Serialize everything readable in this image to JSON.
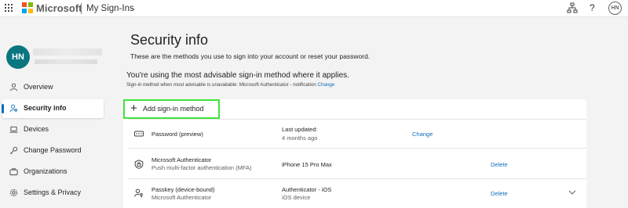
{
  "topbar": {
    "brand": "Microsoft",
    "app_name": "My Sign-Ins",
    "user_initials": "HN",
    "help_label": "?",
    "icons": [
      "app-launcher-icon",
      "microsoft-logo",
      "chevron-down-icon",
      "organization-icon",
      "help-icon"
    ]
  },
  "sidebar": {
    "avatar_initials": "HN",
    "items": [
      {
        "label": "Overview",
        "icon": "person-icon",
        "active": false
      },
      {
        "label": "Security info",
        "icon": "person-key-icon",
        "active": true
      },
      {
        "label": "Devices",
        "icon": "laptop-icon",
        "active": false
      },
      {
        "label": "Change Password",
        "icon": "key-icon",
        "active": false
      },
      {
        "label": "Organizations",
        "icon": "briefcase-icon",
        "active": false
      },
      {
        "label": "Settings & Privacy",
        "icon": "gear-icon",
        "active": false
      }
    ]
  },
  "main": {
    "title": "Security info",
    "subtitle": "These are the methods you use to sign into your account or reset your password.",
    "advice": "You're using the most advisable sign-in method where it applies.",
    "advice_sub": "Sign-in method when most advisable is unavailable: Microsoft Authenticator - notification",
    "advice_link": "Change",
    "add_method_label": "Add sign-in method"
  },
  "methods": [
    {
      "name": "Password (preview)",
      "sub": "",
      "detail1": "Last updated:",
      "detail2": "4 months ago",
      "action": "Change",
      "icon": "password-icon",
      "expandable": false
    },
    {
      "name": "Microsoft Authenticator",
      "sub": "Push multi-factor authentication (MFA)",
      "detail1": "iPhone 15 Pro Max",
      "detail2": "",
      "action": "Delete",
      "icon": "authenticator-lock-icon",
      "expandable": false
    },
    {
      "name": "Passkey (device-bound)",
      "sub": "Microsoft Authenticator",
      "detail1": "Authenticator - iOS",
      "detail2": "iOS device",
      "action": "Delete",
      "icon": "passkey-icon",
      "expandable": true
    }
  ],
  "colors": {
    "accent": "#0f6cbd",
    "avatar_bg": "#0a7680",
    "highlight_border": "#3ee53b",
    "page_bg": "#f3f3f3"
  }
}
